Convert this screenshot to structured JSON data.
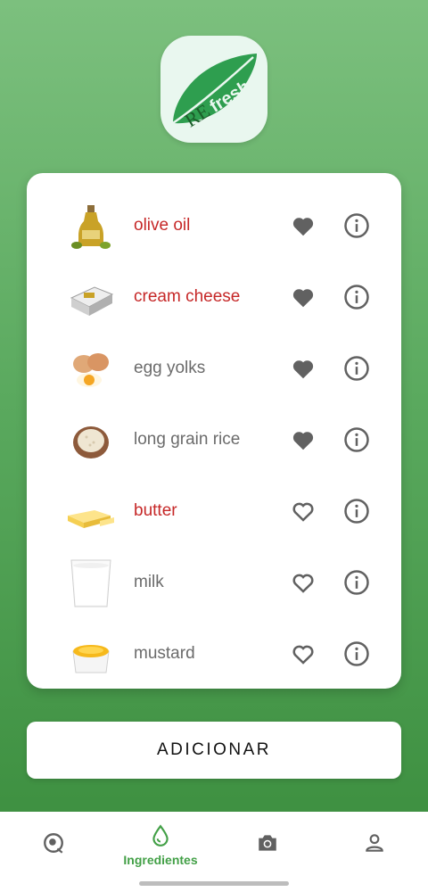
{
  "app": {
    "logo_text_re": "RE",
    "logo_text_fresh": "fresh"
  },
  "ingredients": [
    {
      "name": "olive oil",
      "highlighted": true,
      "favorite": true,
      "image": "olive-oil-bottle"
    },
    {
      "name": "cream cheese",
      "highlighted": true,
      "favorite": true,
      "image": "cream-cheese-package"
    },
    {
      "name": "egg yolks",
      "highlighted": false,
      "favorite": true,
      "image": "eggs"
    },
    {
      "name": "long grain rice",
      "highlighted": false,
      "favorite": true,
      "image": "rice-bowl"
    },
    {
      "name": "butter",
      "highlighted": true,
      "favorite": false,
      "image": "butter-stick"
    },
    {
      "name": "milk",
      "highlighted": false,
      "favorite": false,
      "image": "milk-glass"
    },
    {
      "name": "mustard",
      "highlighted": false,
      "favorite": false,
      "image": "mustard-ramekin"
    }
  ],
  "actions": {
    "add_label": "ADICIONAR"
  },
  "nav": {
    "items": [
      {
        "icon": "eggs-nav-icon",
        "label": ""
      },
      {
        "icon": "drop-icon",
        "label": "Ingredientes",
        "active": true
      },
      {
        "icon": "camera-icon",
        "label": ""
      },
      {
        "icon": "person-icon",
        "label": ""
      }
    ]
  },
  "colors": {
    "accent_green": "#43a047",
    "highlight_red": "#c62828",
    "icon_gray": "#616161"
  }
}
